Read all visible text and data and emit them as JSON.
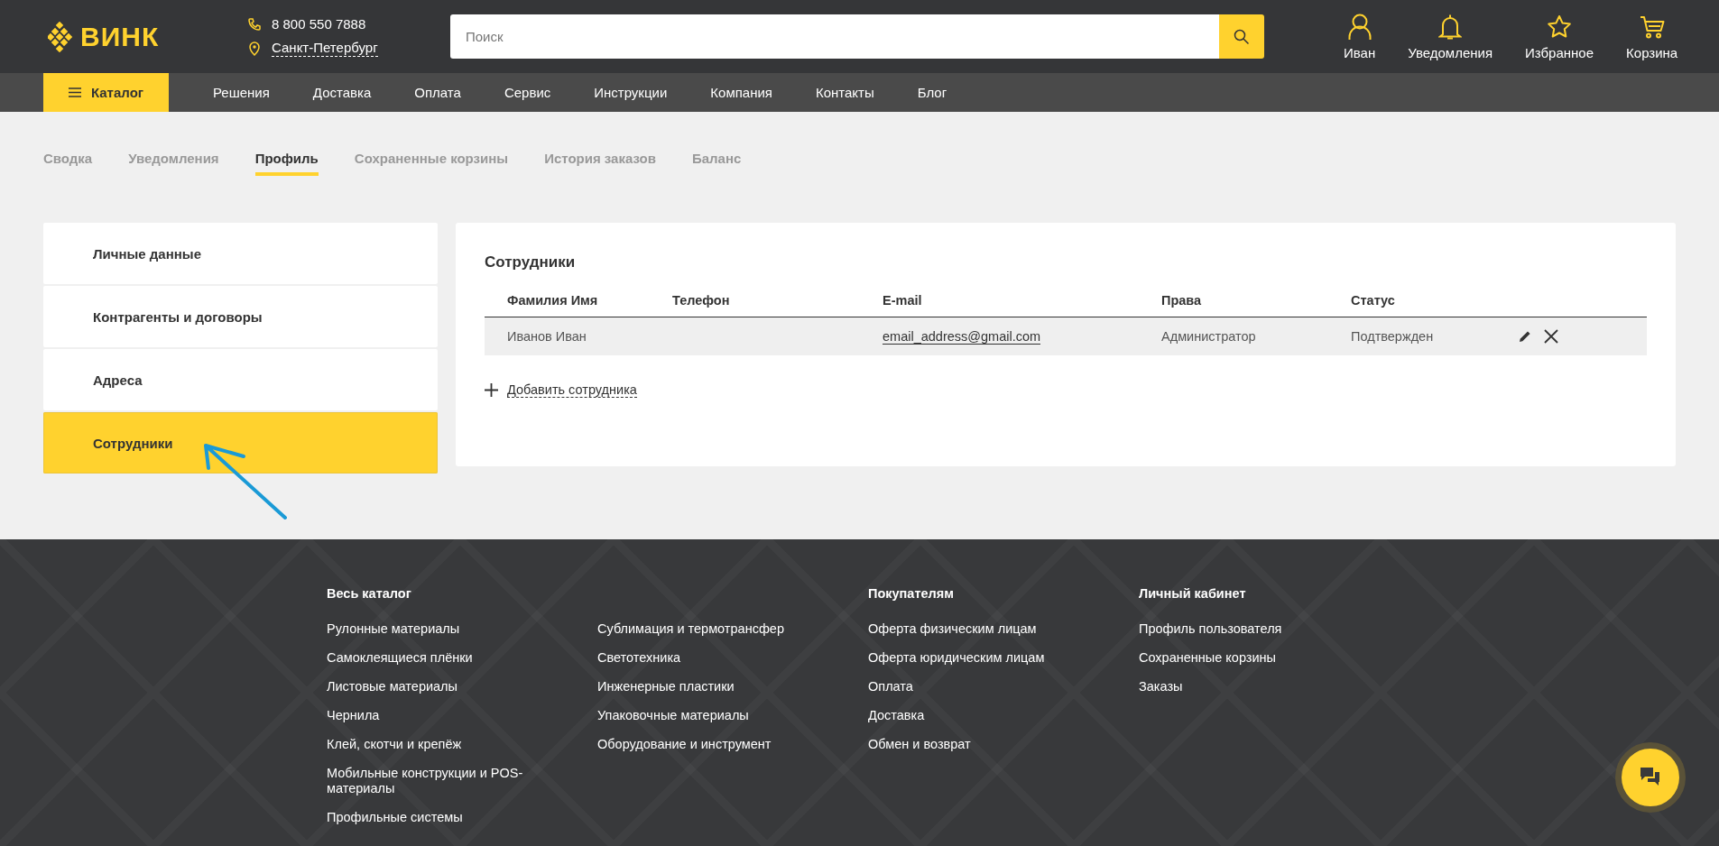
{
  "header": {
    "logo": "ВИНК",
    "phone": "8 800 550 7888",
    "city": "Санкт-Петербург",
    "search": {
      "placeholder": "Поиск"
    },
    "actions": [
      {
        "kind": "user",
        "label": "Иван"
      },
      {
        "kind": "bell",
        "label": "Уведомления"
      },
      {
        "kind": "star",
        "label": "Избранное"
      },
      {
        "kind": "cart",
        "label": "Корзина"
      }
    ]
  },
  "nav": {
    "catalog": "Каталог",
    "links": [
      "Решения",
      "Доставка",
      "Оплата",
      "Сервис",
      "Инструкции",
      "Компания",
      "Контакты",
      "Блог"
    ]
  },
  "tabs": [
    {
      "label": "Сводка",
      "selected": false
    },
    {
      "label": "Уведомления",
      "selected": false
    },
    {
      "label": "Профиль",
      "selected": true
    },
    {
      "label": "Сохраненные корзины",
      "selected": false
    },
    {
      "label": "История заказов",
      "selected": false
    },
    {
      "label": "Баланс",
      "selected": false
    }
  ],
  "sidebar": {
    "items": [
      {
        "label": "Личные данные",
        "selected": false
      },
      {
        "label": "Контрагенты и договоры",
        "selected": false
      },
      {
        "label": "Адреса",
        "selected": false
      },
      {
        "label": "Сотрудники",
        "selected": true
      }
    ]
  },
  "employees": {
    "title": "Сотрудники",
    "columns": [
      "Фамилия Имя",
      "Телефон",
      "E-mail",
      "Права",
      "Статус"
    ],
    "rows": [
      {
        "name": "Иванов Иван",
        "email": "email_address@gmail.com",
        "rights": "Администратор",
        "status": "Подтвержден"
      }
    ],
    "add_label": "Добавить сотрудника"
  },
  "footer": {
    "columns": [
      {
        "heading": "Весь каталог",
        "links": [
          "Рулонные материалы",
          "Самоклеящиеся плёнки",
          "Листовые материалы",
          "Чернила",
          "Клей, скотчи и крепёж",
          "Мобильные конструкции и POS-материалы",
          "Профильные системы"
        ]
      },
      {
        "links": [
          "Сублимация и термотрансфер",
          "Светотехника",
          "Инженерные пластики",
          "Упаковочные материалы",
          "Оборудование и инструмент"
        ]
      },
      {
        "heading": "Покупателям",
        "links": [
          "Оферта физическим лицам",
          "Оферта юридическим лицам",
          "Оплата",
          "Доставка",
          "Обмен и возврат"
        ]
      },
      {
        "heading": "Личный кабинет",
        "links": [
          "Профиль пользователя",
          "Сохраненные корзины",
          "Заказы"
        ]
      }
    ]
  }
}
